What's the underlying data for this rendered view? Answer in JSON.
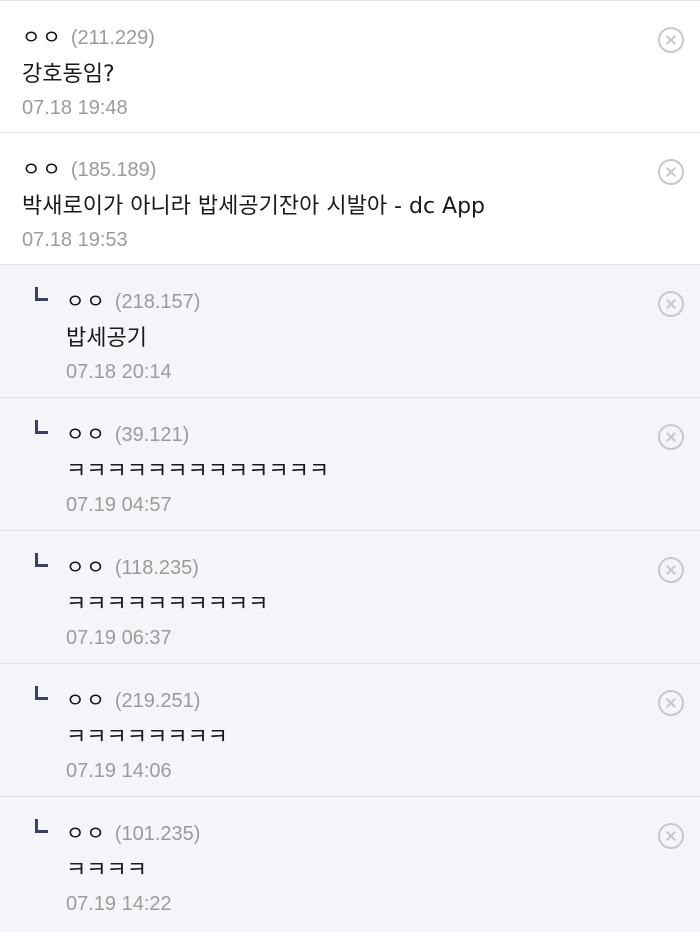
{
  "comments": [
    {
      "reply": false,
      "nick": "ㅇㅇ",
      "ip": "(211.229)",
      "text": "강호동임?",
      "date": "07.18 19:48"
    },
    {
      "reply": false,
      "nick": "ㅇㅇ",
      "ip": "(185.189)",
      "text": "박새로이가 아니라 밥세공기잔아 시발아 - dc App",
      "date": "07.18 19:53"
    },
    {
      "reply": true,
      "nick": "ㅇㅇ",
      "ip": "(218.157)",
      "text": "밥세공기",
      "date": "07.18 20:14"
    },
    {
      "reply": true,
      "nick": "ㅇㅇ",
      "ip": "(39.121)",
      "text": "ㅋㅋㅋㅋㅋㅋㅋㅋㅋㅋㅋㅋㅋ",
      "date": "07.19 04:57"
    },
    {
      "reply": true,
      "nick": "ㅇㅇ",
      "ip": "(118.235)",
      "text": "ㅋㅋㅋㅋㅋㅋㅋㅋㅋㅋ",
      "date": "07.19 06:37"
    },
    {
      "reply": true,
      "nick": "ㅇㅇ",
      "ip": "(219.251)",
      "text": "ㅋㅋㅋㅋㅋㅋㅋㅋ",
      "date": "07.19 14:06"
    },
    {
      "reply": true,
      "nick": "ㅇㅇ",
      "ip": "(101.235)",
      "text": "ㅋㅋㅋㅋ",
      "date": "07.19 14:22"
    }
  ],
  "icons": {
    "reply": "reply-arrow-icon",
    "delete": "close-circle-icon"
  },
  "colors": {
    "reply_background": "#f3f5f8",
    "reply_arrow": "#3a4163",
    "ip_text": "#9a9a9a",
    "date_text": "#9c9c9c",
    "close_icon": "#c5c8cd"
  }
}
